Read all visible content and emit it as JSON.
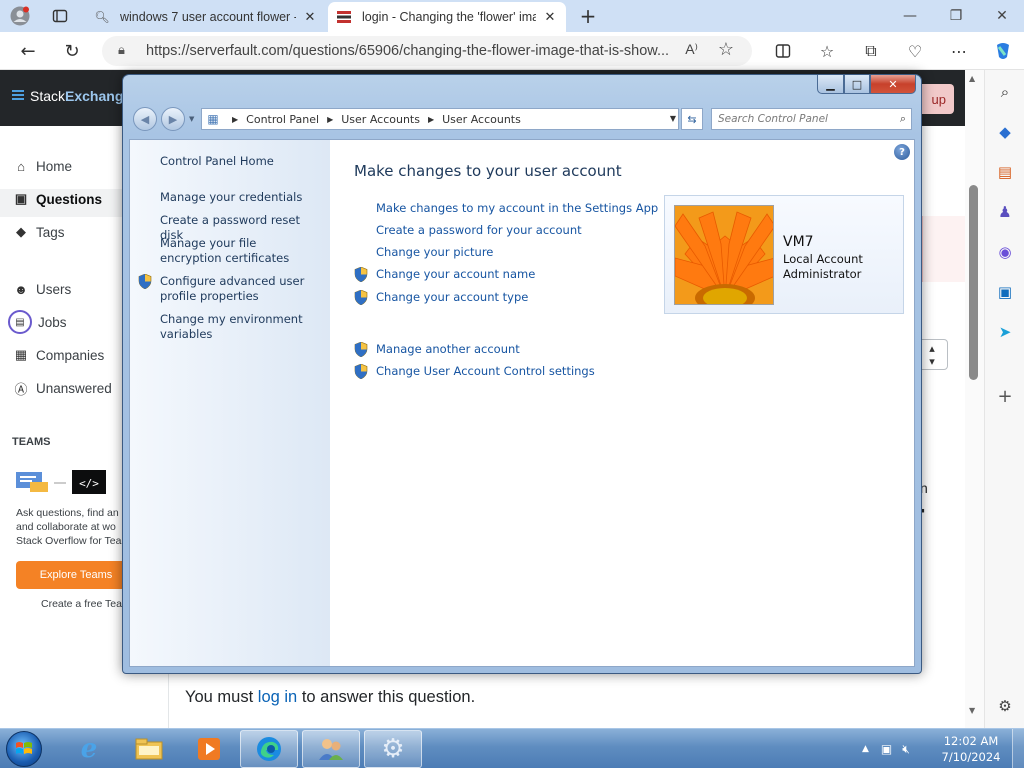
{
  "browser": {
    "tabs": [
      {
        "label": "windows 7 user account flower -",
        "icon": "search-icon"
      },
      {
        "label": "login - Changing the 'flower' ima",
        "icon": "serverfault-icon"
      }
    ],
    "url": "https://serverfault.com/questions/65906/changing-the-flower-image-that-is-show...",
    "read_aloud": "A⁾"
  },
  "stackexchange": {
    "logo_part1": "Stack",
    "logo_part2": "Exchange",
    "signup_partial": "up",
    "nav": [
      {
        "label": "Home",
        "icon": "home-icon"
      },
      {
        "label": "Questions",
        "icon": "questions-icon"
      },
      {
        "label": "Tags",
        "icon": "tag-icon"
      },
      {
        "label": "Users",
        "icon": "users-icon"
      },
      {
        "label": "Jobs",
        "icon": "briefcase-icon"
      },
      {
        "label": "Companies",
        "icon": "companies-icon"
      },
      {
        "label": "Unanswered",
        "icon": "unanswered-icon"
      }
    ],
    "teams_heading": "TEAMS",
    "teams_text": "Ask questions, find an and collaborate at wo Stack Overflow for Tea",
    "explore_button": "Explore Teams",
    "create_team": "Create a free Tea",
    "answer_prefix": "You must ",
    "answer_link": "log in",
    "answer_suffix": " to answer this question.",
    "edge_char_n": "n",
    "edge_char_dot": "▪"
  },
  "control_panel": {
    "address_crumbs": [
      "Control Panel",
      "User Accounts",
      "User Accounts"
    ],
    "search_placeholder": "Search Control Panel",
    "left_home": "Control Panel Home",
    "left_links": [
      "Manage your credentials",
      "Create a password reset disk",
      "Manage your file encryption certificates",
      "Configure advanced user profile properties",
      "Change my environment variables"
    ],
    "heading": "Make changes to your user account",
    "links": [
      "Make changes to my account in the Settings App",
      "Create a password for your account",
      "Change your picture",
      "Change your account name",
      "Change your account type",
      "Manage another account",
      "Change User Account Control settings"
    ],
    "help": "?",
    "user": {
      "name": "VM7",
      "type": "Local Account",
      "role": "Administrator"
    }
  },
  "taskbar": {
    "time": "12:02 AM",
    "date": "7/10/2024"
  }
}
